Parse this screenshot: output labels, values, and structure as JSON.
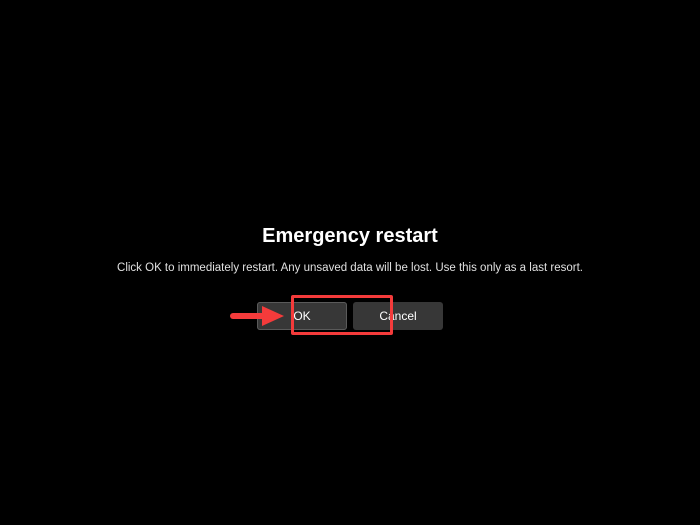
{
  "dialog": {
    "title": "Emergency restart",
    "message": "Click OK to immediately restart. Any unsaved data will be lost. Use this only as a last resort.",
    "ok_label": "OK",
    "cancel_label": "Cancel"
  },
  "annotation": {
    "arrow_color": "#f43b3b",
    "highlight_color": "#f43b3b"
  }
}
